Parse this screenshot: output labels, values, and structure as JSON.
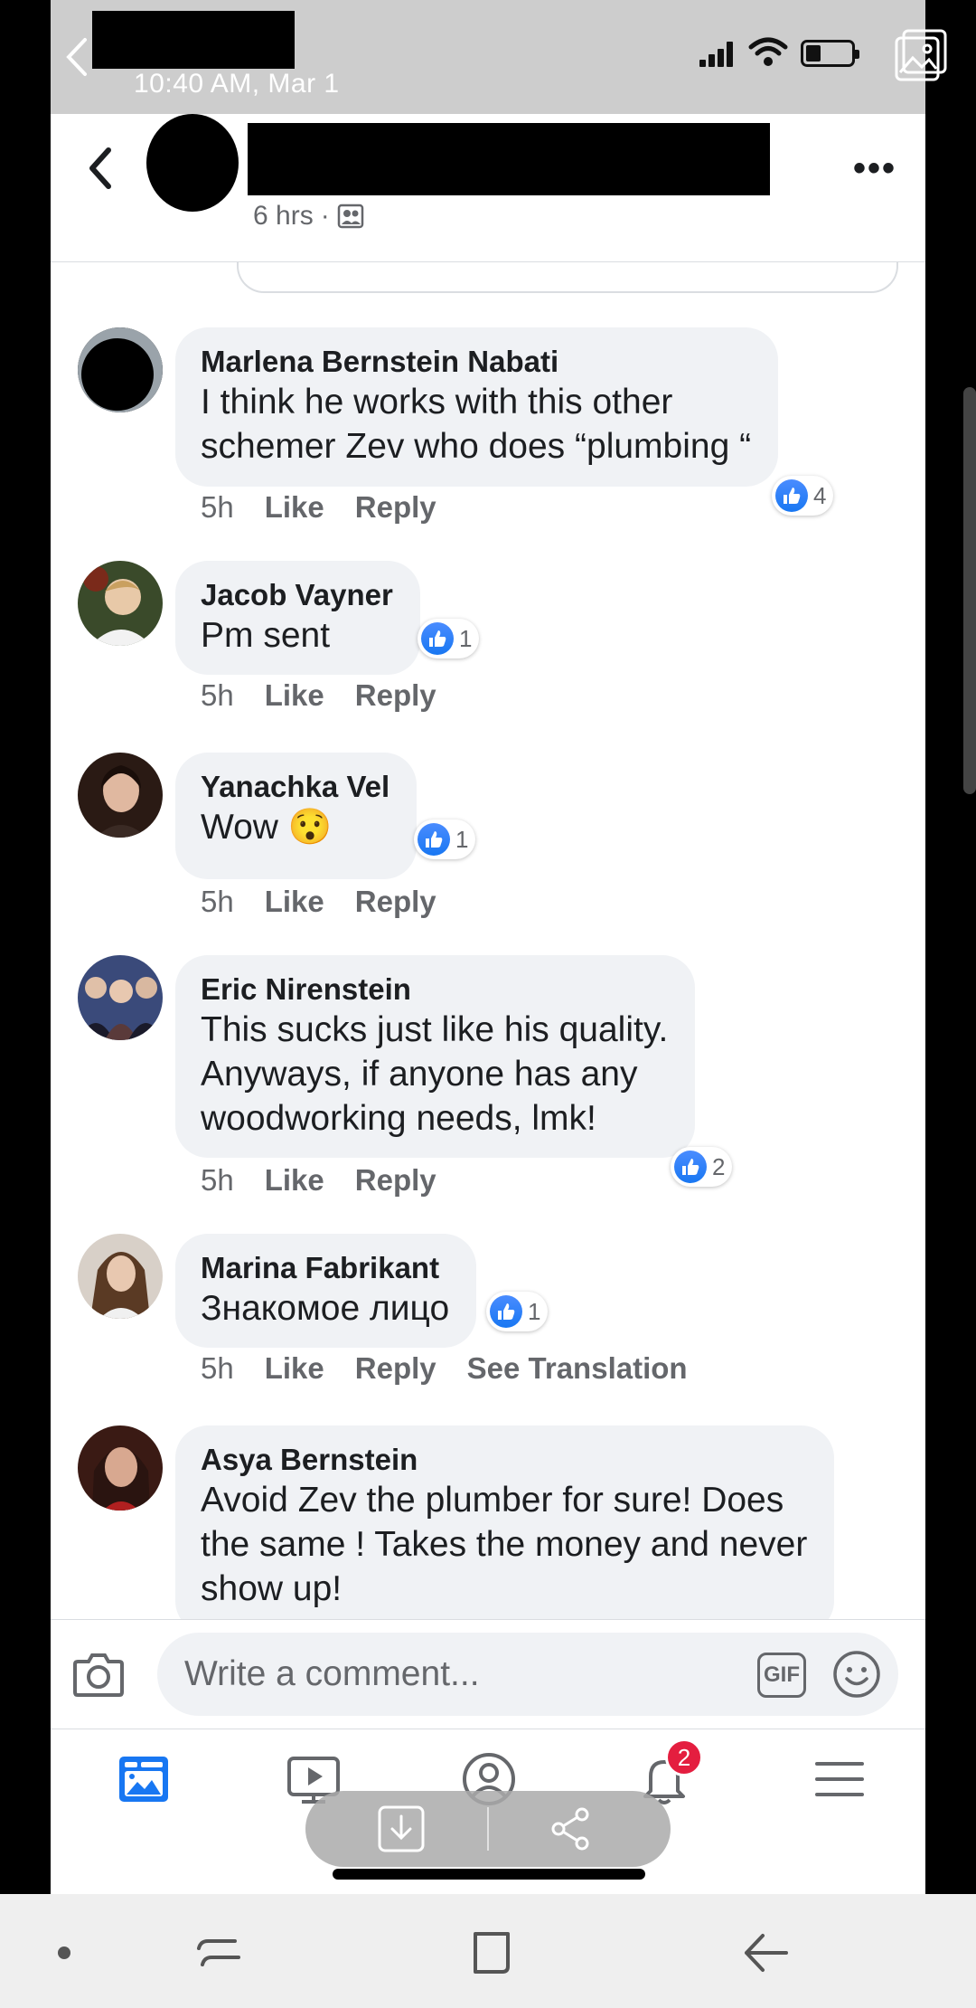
{
  "status_bar": {
    "time": "10:40 AM, Mar 1"
  },
  "post": {
    "time": "6 hrs",
    "separator": "·",
    "audience_icon": "friends-icon",
    "more": "•••"
  },
  "comments": [
    {
      "author": "Marlena Bernstein Nabati",
      "lines": [
        "I think he works with this other",
        "schemer Zev who does “plumbing “"
      ],
      "time": "5h",
      "like": "Like",
      "reply": "Reply",
      "reactions": "4"
    },
    {
      "author": "Jacob Vayner",
      "lines": [
        "Pm sent"
      ],
      "time": "5h",
      "like": "Like",
      "reply": "Reply",
      "reactions": "1"
    },
    {
      "author": "Yanachka Vel",
      "lines": [
        "Wow 😯"
      ],
      "time": "5h",
      "like": "Like",
      "reply": "Reply",
      "reactions": "1"
    },
    {
      "author": "Eric Nirenstein",
      "lines": [
        "This sucks just like his quality.",
        "Anyways, if anyone has any",
        "woodworking needs, lmk!"
      ],
      "time": "5h",
      "like": "Like",
      "reply": "Reply",
      "reactions": "2"
    },
    {
      "author": "Marina Fabrikant",
      "lines": [
        "Знакомое лицо"
      ],
      "time": "5h",
      "like": "Like",
      "reply": "Reply",
      "see_translation": "See Translation",
      "reactions": "1"
    },
    {
      "author": "Asya Bernstein",
      "lines": [
        "Avoid Zev the plumber for sure! Does",
        "the same ! Takes the money and never",
        "show up!"
      ]
    }
  ],
  "composer": {
    "placeholder": "Write a comment...",
    "gif": "GIF"
  },
  "bottom_nav": {
    "notifications_badge": "2",
    "items": [
      "news-feed-icon",
      "watch-icon",
      "profile-icon",
      "notifications-icon",
      "menu-icon"
    ]
  },
  "colors": {
    "accent": "#1877f2",
    "bubble": "#f0f2f5",
    "secondary_text": "#65676b",
    "badge": "#e41e3f"
  }
}
